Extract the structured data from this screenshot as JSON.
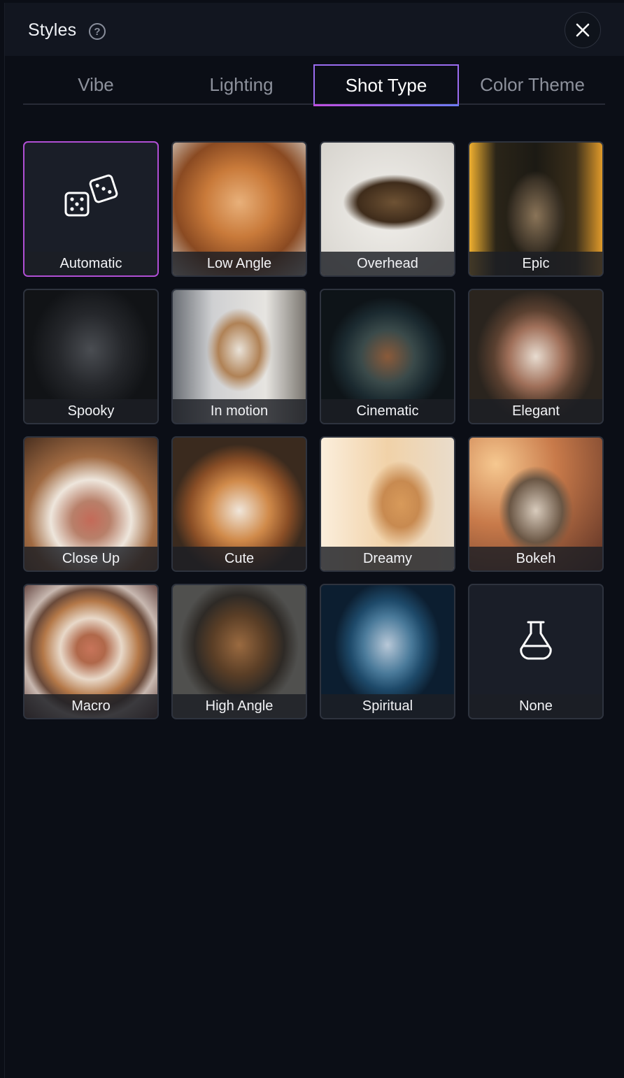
{
  "header": {
    "title": "Styles",
    "help_icon": "question-circle-icon",
    "close_icon": "close-x-icon"
  },
  "tabs": [
    {
      "label": "Vibe",
      "active": false
    },
    {
      "label": "Lighting",
      "active": false
    },
    {
      "label": "Shot Type",
      "active": true
    },
    {
      "label": "Color Theme",
      "active": false
    }
  ],
  "colors": {
    "accent_start": "#c04ee0",
    "accent_end": "#6d7cf5",
    "background": "#0b0e16",
    "selected_border": "#b04fd4"
  },
  "styles": [
    {
      "label": "Automatic",
      "selected": true,
      "icon": "dice-icon"
    },
    {
      "label": "Low Angle",
      "selected": false
    },
    {
      "label": "Overhead",
      "selected": false
    },
    {
      "label": "Epic",
      "selected": false
    },
    {
      "label": "Spooky",
      "selected": false
    },
    {
      "label": "In motion",
      "selected": false
    },
    {
      "label": "Cinematic",
      "selected": false
    },
    {
      "label": "Elegant",
      "selected": false
    },
    {
      "label": "Close Up",
      "selected": false
    },
    {
      "label": "Cute",
      "selected": false
    },
    {
      "label": "Dreamy",
      "selected": false
    },
    {
      "label": "Bokeh",
      "selected": false
    },
    {
      "label": "Macro",
      "selected": false
    },
    {
      "label": "High Angle",
      "selected": false
    },
    {
      "label": "Spiritual",
      "selected": false
    },
    {
      "label": "None",
      "selected": false,
      "icon": "flask-icon"
    }
  ]
}
